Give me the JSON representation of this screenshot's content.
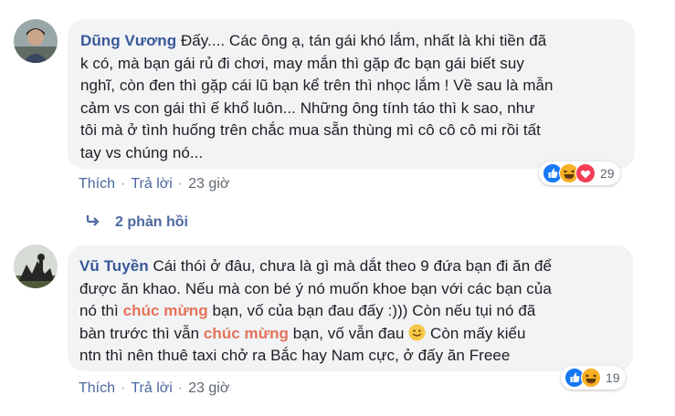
{
  "comments": [
    {
      "author": "Dũng Vương",
      "lines": [
        "Đấy.... Các ông ạ, tán gái khó lắm, nhất là khi tiền đã",
        "k có, mà bạn gái rủ đi chơi, may mắn thì gặp đc bạn gái biết suy",
        "nghĩ, còn đen thì gặp cái lũ bạn kể trên thì nhọc lắm ! Về sau là mẫn",
        "cảm vs con gái thì ế khổ luôn... Những ông tính táo thì k sao, như",
        "tôi mà ở tình huống trên chắc mua sẵn thùng mì cô cô cô mi rồi tất",
        "tay vs chúng nó..."
      ],
      "like_label": "Thích",
      "reply_label": "Trả lời",
      "time": "23 giờ",
      "reaction_count": "29",
      "reaction_icons": [
        "like-icon",
        "haha-icon",
        "love-icon"
      ],
      "replies_label": "2 phản hồi"
    },
    {
      "author": "Vũ Tuyền",
      "line1": "Cái thói ở đâu, chưa là gì mà dắt theo 9 đứa bạn đi ăn để",
      "line2": "được ăn khao. Nếu mà con bé ý nó muốn khoe bạn với các bạn của",
      "line3_pre": "nó thì",
      "highlight": "chúc mừng",
      "line3_post": "bạn, vố của bạn đau đấy :))) Còn nếu tụi nó đã",
      "line4_pre": "bàn trước thì vẫn",
      "line4_post": "bạn, vố vẫn đau",
      "line4_tail": "Còn mấy kiểu",
      "line5": "ntn thì nên thuê taxi chở ra Bắc hay Nam cực, ở đấy ăn Freee",
      "like_label": "Thích",
      "reply_label": "Trả lời",
      "time": "23 giờ",
      "reaction_count": "19",
      "reaction_icons": [
        "like-icon",
        "haha-icon"
      ]
    }
  ],
  "colors": {
    "bubble": "#f2f3f5",
    "author": "#385898",
    "link": "#4b67a1",
    "highlight": "#e4735b",
    "like": "#1877f2",
    "haha": "#f7b125",
    "love": "#f33e58"
  }
}
